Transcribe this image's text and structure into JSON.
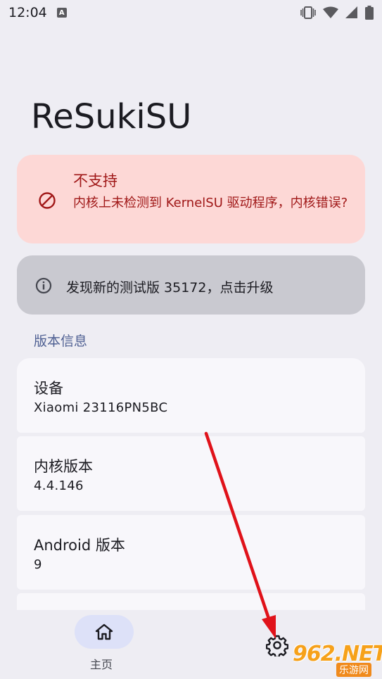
{
  "status_bar": {
    "time": "12:04",
    "notification_badge": "A",
    "icons": [
      "vibrate-icon",
      "wifi-icon",
      "signal-icon",
      "battery-icon"
    ]
  },
  "app": {
    "title": "ReSukiSU"
  },
  "error_card": {
    "icon": "block-icon",
    "title": "不支持",
    "description": "内核上未检测到 KernelSU 驱动程序，内核错误?"
  },
  "update_card": {
    "icon": "info-icon",
    "text": "发现新的测试版 35172，点击升级"
  },
  "section": {
    "label": "版本信息"
  },
  "info": [
    {
      "label": "设备",
      "value": "Xiaomi 23116PN5BC"
    },
    {
      "label": "内核版本",
      "value": "4.4.146"
    },
    {
      "label": "Android 版本",
      "value": "9"
    }
  ],
  "nav": {
    "home_label": "主页",
    "home_icon": "home-icon",
    "settings_icon": "gear-icon"
  },
  "watermark": {
    "main": "962.NET",
    "sub": "乐游网"
  },
  "colors": {
    "accent": "#4e5f92",
    "error_bg": "#fdd8d6",
    "error_text": "#a01818",
    "arrow": "#e0121a"
  }
}
